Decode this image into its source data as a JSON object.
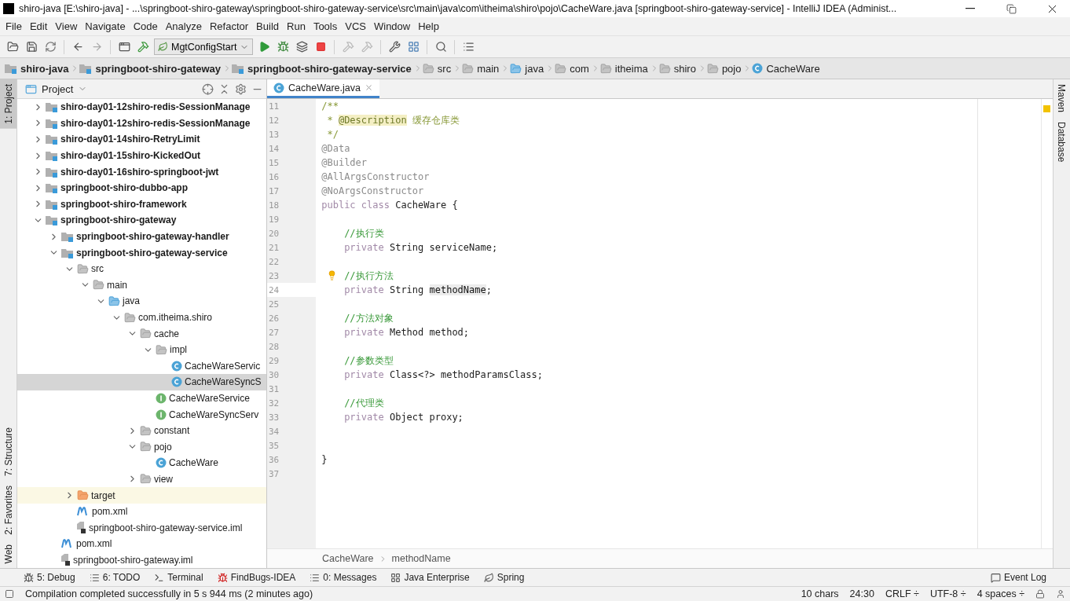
{
  "window": {
    "title": "shiro-java [E:\\shiro-java] - ...\\springboot-shiro-gateway\\springboot-shiro-gateway-service\\src\\main\\java\\com\\itheima\\shiro\\pojo\\CacheWare.java [springboot-shiro-gateway-service] - IntelliJ IDEA (Administ..."
  },
  "menu": [
    "File",
    "Edit",
    "View",
    "Navigate",
    "Code",
    "Analyze",
    "Refactor",
    "Build",
    "Run",
    "Tools",
    "VCS",
    "Window",
    "Help"
  ],
  "toolbar": {
    "run_config": "MgtConfigStart"
  },
  "nav_bar": [
    {
      "label": "shiro-java",
      "kind": "module"
    },
    {
      "label": "springboot-shiro-gateway",
      "kind": "module"
    },
    {
      "label": "springboot-shiro-gateway-service",
      "kind": "module"
    },
    {
      "label": "src",
      "kind": "folder"
    },
    {
      "label": "main",
      "kind": "folder"
    },
    {
      "label": "java",
      "kind": "source-folder"
    },
    {
      "label": "com",
      "kind": "folder"
    },
    {
      "label": "itheima",
      "kind": "folder"
    },
    {
      "label": "shiro",
      "kind": "folder"
    },
    {
      "label": "pojo",
      "kind": "folder"
    },
    {
      "label": "CacheWare",
      "kind": "class"
    }
  ],
  "left_stripe": {
    "top": [
      {
        "label": "1: Project",
        "selected": true
      }
    ],
    "bottom": [
      {
        "label": "7: Structure",
        "selected": false
      },
      {
        "label": "2: Favorites",
        "selected": false
      },
      {
        "label": "Web",
        "selected": false
      }
    ]
  },
  "right_stripe": [
    {
      "label": "Maven",
      "selected": false
    },
    {
      "label": "Database",
      "selected": false
    }
  ],
  "project_panel": {
    "title": "Project",
    "tree": [
      {
        "label": "shiro-day01-12shiro-redis-SessionManage",
        "kind": "module",
        "expanded": false,
        "selected": false
      },
      {
        "label": "shiro-day01-12shiro-redis-SessionManage",
        "kind": "module",
        "expanded": false,
        "selected": false
      },
      {
        "label": "shiro-day01-14shiro-RetryLimit",
        "kind": "module",
        "expanded": false,
        "selected": false
      },
      {
        "label": "shiro-day01-15shiro-KickedOut",
        "kind": "module",
        "expanded": false,
        "selected": false
      },
      {
        "label": "shiro-day01-16shiro-springboot-jwt",
        "kind": "module",
        "expanded": false,
        "selected": false
      },
      {
        "label": "springboot-shiro-dubbo-app",
        "kind": "module",
        "expanded": false,
        "selected": false
      },
      {
        "label": "springboot-shiro-framework",
        "kind": "module",
        "expanded": false,
        "selected": false
      },
      {
        "label": "springboot-shiro-gateway",
        "kind": "module",
        "expanded": true,
        "selected": false,
        "children": [
          {
            "label": "springboot-shiro-gateway-handler",
            "kind": "module",
            "expanded": false,
            "selected": false
          },
          {
            "label": "springboot-shiro-gateway-service",
            "kind": "module",
            "expanded": true,
            "selected": false,
            "children": [
              {
                "label": "src",
                "kind": "folder",
                "expanded": true,
                "selected": false,
                "children": [
                  {
                    "label": "main",
                    "kind": "folder",
                    "expanded": true,
                    "selected": false,
                    "children": [
                      {
                        "label": "java",
                        "kind": "source-folder",
                        "expanded": true,
                        "selected": false,
                        "children": [
                          {
                            "label": "com.itheima.shiro",
                            "kind": "package",
                            "expanded": true,
                            "selected": false,
                            "children": [
                              {
                                "label": "cache",
                                "kind": "package",
                                "expanded": true,
                                "selected": false,
                                "children": [
                                  {
                                    "label": "impl",
                                    "kind": "package",
                                    "expanded": true,
                                    "selected": false,
                                    "children": [
                                      {
                                        "label": "CacheWareServic",
                                        "kind": "class",
                                        "selected": false
                                      },
                                      {
                                        "label": "CacheWareSyncS",
                                        "kind": "class",
                                        "selected": true
                                      }
                                    ]
                                  },
                                  {
                                    "label": "CacheWareService",
                                    "kind": "interface",
                                    "selected": false
                                  },
                                  {
                                    "label": "CacheWareSyncServ",
                                    "kind": "interface",
                                    "selected": false
                                  }
                                ]
                              },
                              {
                                "label": "constant",
                                "kind": "package",
                                "expanded": false,
                                "selected": false
                              },
                              {
                                "label": "pojo",
                                "kind": "package",
                                "expanded": true,
                                "selected": false,
                                "children": [
                                  {
                                    "label": "CacheWare",
                                    "kind": "class",
                                    "selected": false
                                  }
                                ]
                              },
                              {
                                "label": "view",
                                "kind": "package",
                                "expanded": false,
                                "selected": false
                              }
                            ]
                          }
                        ]
                      }
                    ]
                  }
                ]
              },
              {
                "label": "target",
                "kind": "excluded-folder",
                "expanded": false,
                "selected": false
              },
              {
                "label": "pom.xml",
                "kind": "maven",
                "selected": false
              },
              {
                "label": "springboot-shiro-gateway-service.iml",
                "kind": "iml",
                "selected": false
              }
            ]
          },
          {
            "label": "pom.xml",
            "kind": "maven",
            "selected": false
          },
          {
            "label": "springboot-shiro-gateway.iml",
            "kind": "iml",
            "selected": false
          }
        ]
      }
    ]
  },
  "editor": {
    "tabs": [
      {
        "label": "CacheWare.java",
        "selected": true
      }
    ],
    "lines": [
      {
        "number": "11",
        "current": false,
        "segments": [
          {
            "text": "/**",
            "kind": "doc"
          }
        ]
      },
      {
        "number": "12",
        "current": false,
        "segments": [
          {
            "text": " * ",
            "kind": "doc"
          },
          {
            "text": "@Description",
            "kind": "doc-tag"
          },
          {
            "text": " 缓存仓库类",
            "kind": "doc"
          }
        ]
      },
      {
        "number": "13",
        "current": false,
        "segments": [
          {
            "text": " */",
            "kind": "doc"
          }
        ]
      },
      {
        "number": "14",
        "current": false,
        "segments": [
          {
            "text": "@Data",
            "kind": "annotation"
          }
        ]
      },
      {
        "number": "15",
        "current": false,
        "segments": [
          {
            "text": "@Builder",
            "kind": "annotation"
          }
        ]
      },
      {
        "number": "16",
        "current": false,
        "segments": [
          {
            "text": "@AllArgsConstructor",
            "kind": "annotation"
          }
        ]
      },
      {
        "number": "17",
        "current": false,
        "segments": [
          {
            "text": "@NoArgsConstructor",
            "kind": "annotation"
          }
        ]
      },
      {
        "number": "18",
        "current": false,
        "segments": [
          {
            "text": "public class",
            "kind": "keyword"
          },
          {
            "text": " CacheWare {",
            "kind": "plain"
          }
        ]
      },
      {
        "number": "19",
        "current": false
      },
      {
        "number": "20",
        "current": false,
        "segments": [
          {
            "text": "    //执行类",
            "kind": "comment"
          }
        ]
      },
      {
        "number": "21",
        "current": false,
        "segments": [
          {
            "text": "    private",
            "kind": "keyword"
          },
          {
            "text": " String serviceName;",
            "kind": "plain"
          }
        ]
      },
      {
        "number": "22",
        "current": false
      },
      {
        "number": "23",
        "current": false,
        "bulb": true,
        "segments": [
          {
            "text": "    //执行方法",
            "kind": "comment"
          }
        ]
      },
      {
        "number": "24",
        "current": true,
        "segments": [
          {
            "text": "    private",
            "kind": "keyword"
          },
          {
            "text": " String ",
            "kind": "plain"
          },
          {
            "text": "methodName",
            "kind": "usage"
          },
          {
            "text": ";",
            "kind": "plain"
          }
        ]
      },
      {
        "number": "25",
        "current": false
      },
      {
        "number": "26",
        "current": false,
        "segments": [
          {
            "text": "    //方法对象",
            "kind": "comment"
          }
        ]
      },
      {
        "number": "27",
        "current": false,
        "segments": [
          {
            "text": "    private",
            "kind": "keyword"
          },
          {
            "text": " Method method;",
            "kind": "plain"
          }
        ]
      },
      {
        "number": "28",
        "current": false
      },
      {
        "number": "29",
        "current": false,
        "segments": [
          {
            "text": "    //参数类型",
            "kind": "comment"
          }
        ]
      },
      {
        "number": "30",
        "current": false,
        "segments": [
          {
            "text": "    private",
            "kind": "keyword"
          },
          {
            "text": " Class<?> methodParamsClass;",
            "kind": "plain"
          }
        ]
      },
      {
        "number": "31",
        "current": false
      },
      {
        "number": "32",
        "current": false,
        "segments": [
          {
            "text": "    //代理类",
            "kind": "comment"
          }
        ]
      },
      {
        "number": "33",
        "current": false,
        "segments": [
          {
            "text": "    private",
            "kind": "keyword"
          },
          {
            "text": " Object proxy;",
            "kind": "plain"
          }
        ]
      },
      {
        "number": "34",
        "current": false
      },
      {
        "number": "35",
        "current": false
      },
      {
        "number": "36",
        "current": false,
        "segments": [
          {
            "text": "}",
            "kind": "plain"
          }
        ]
      },
      {
        "number": "37",
        "current": false
      }
    ],
    "breadcrumbs": [
      "CacheWare",
      "methodName"
    ]
  },
  "tool_tabs": [
    {
      "label": "5: Debug",
      "kind": "debug"
    },
    {
      "label": "6: TODO",
      "kind": "todo"
    },
    {
      "label": "Terminal",
      "kind": "terminal"
    },
    {
      "label": "FindBugs-IDEA",
      "kind": "findbugs"
    },
    {
      "label": "0: Messages",
      "kind": "messages"
    },
    {
      "label": "Java Enterprise",
      "kind": "enterprise"
    },
    {
      "label": "Spring",
      "kind": "spring"
    }
  ],
  "event_log": "Event Log",
  "status_bar": {
    "message": "Compilation completed successfully in 5 s 944 ms (2 minutes ago)",
    "selection": "10 chars",
    "position": "24:30",
    "line_separator": "CRLF ÷",
    "encoding": "UTF-8 ÷",
    "indent": "4 spaces ÷"
  }
}
